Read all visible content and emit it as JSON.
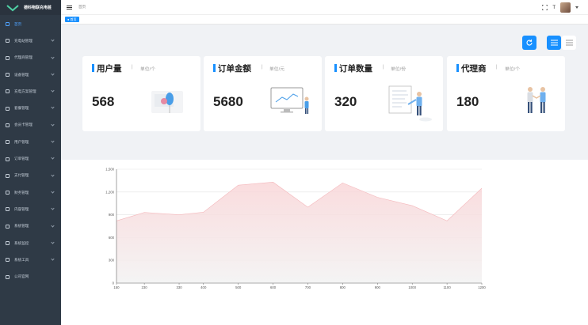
{
  "app": {
    "title": "德科物联充电桩"
  },
  "sidebar": {
    "items": [
      {
        "label": "首页",
        "icon": "home-icon",
        "active": true,
        "arrow": false
      },
      {
        "label": "充电站管理",
        "icon": "station-icon",
        "arrow": true
      },
      {
        "label": "代理商管理",
        "icon": "agent-icon",
        "arrow": true
      },
      {
        "label": "设备管理",
        "icon": "device-icon",
        "arrow": true
      },
      {
        "label": "充电方案管理",
        "icon": "plan-icon",
        "arrow": true
      },
      {
        "label": "套餐管理",
        "icon": "package-icon",
        "arrow": true
      },
      {
        "label": "会员卡管理",
        "icon": "card-icon",
        "arrow": true
      },
      {
        "label": "用户管理",
        "icon": "user-icon",
        "arrow": true
      },
      {
        "label": "订单管理",
        "icon": "cart-icon",
        "arrow": true
      },
      {
        "label": "支付管理",
        "icon": "yen-icon",
        "arrow": true
      },
      {
        "label": "财务管理",
        "icon": "finance-icon",
        "arrow": true
      },
      {
        "label": "内容管理",
        "icon": "content-icon",
        "arrow": true
      },
      {
        "label": "系统管理",
        "icon": "gear-icon",
        "arrow": true
      },
      {
        "label": "系统监控",
        "icon": "monitor-icon",
        "arrow": true
      },
      {
        "label": "系统工具",
        "icon": "tool-icon",
        "arrow": true
      },
      {
        "label": "公司官网",
        "icon": "send-icon",
        "arrow": false
      }
    ]
  },
  "header": {
    "breadcrumb": "首页",
    "text_size_label": "T"
  },
  "tags": {
    "home": "首页"
  },
  "cards": [
    {
      "title": "用户量",
      "unit": "单位/个",
      "value": "568"
    },
    {
      "title": "订单金额",
      "unit": "单位/元",
      "value": "5680"
    },
    {
      "title": "订单数量",
      "unit": "单位/份",
      "value": "320"
    },
    {
      "title": "代理商",
      "unit": "单位/个",
      "value": "180"
    }
  ],
  "colors": {
    "accent": "#1890ff",
    "sidebar": "#2f3a46",
    "area_top": "#f9d6d8",
    "area_line": "#f4b7bb"
  },
  "chart_data": {
    "type": "area",
    "x": [
      150,
      230,
      330,
      400,
      500,
      600,
      700,
      800,
      900,
      1000,
      1100,
      1200
    ],
    "x_tick_labels": [
      "150",
      "230",
      "330",
      "400",
      "500",
      "600",
      "700",
      "800",
      "900",
      "1000",
      "1100",
      "1200"
    ],
    "series": [
      {
        "values": [
          820,
          930,
          900,
          934,
          1290,
          1330,
          1000,
          1320,
          1130,
          1020,
          820,
          1250
        ]
      }
    ],
    "ylim": [
      0,
      1500
    ],
    "y_ticks": [
      0,
      300,
      600,
      900,
      1200,
      1500
    ],
    "y_tick_labels": [
      "0",
      "300",
      "600",
      "900",
      "1,200",
      "1,500"
    ],
    "grid": true
  }
}
